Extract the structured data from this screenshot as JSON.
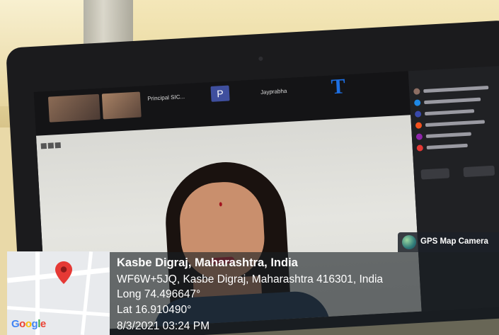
{
  "meeting": {
    "tile_label_1": "Principal SIC...",
    "tile_letter": "P",
    "tile_label_2": "Jayprabha",
    "tile_letter_2": "T"
  },
  "gps_stamp": {
    "app_name": "GPS Map Camera",
    "location_title": "Kasbe Digraj, Maharashtra, India",
    "address": "WF6W+5JQ, Kasbe Digraj, Maharashtra 416301, India",
    "longitude": "Long 74.496647°",
    "latitude": "Lat 16.910490°",
    "datetime": "8/3/2021 03:24 PM"
  },
  "map": {
    "provider_logo": [
      "G",
      "o",
      "o",
      "g",
      "l",
      "e"
    ],
    "pin_icon": "map-pin-icon",
    "pin_color": "#e53935"
  },
  "colors": {
    "overlay_bg": "#1c2128",
    "accent_blue": "#1d6fe3"
  }
}
